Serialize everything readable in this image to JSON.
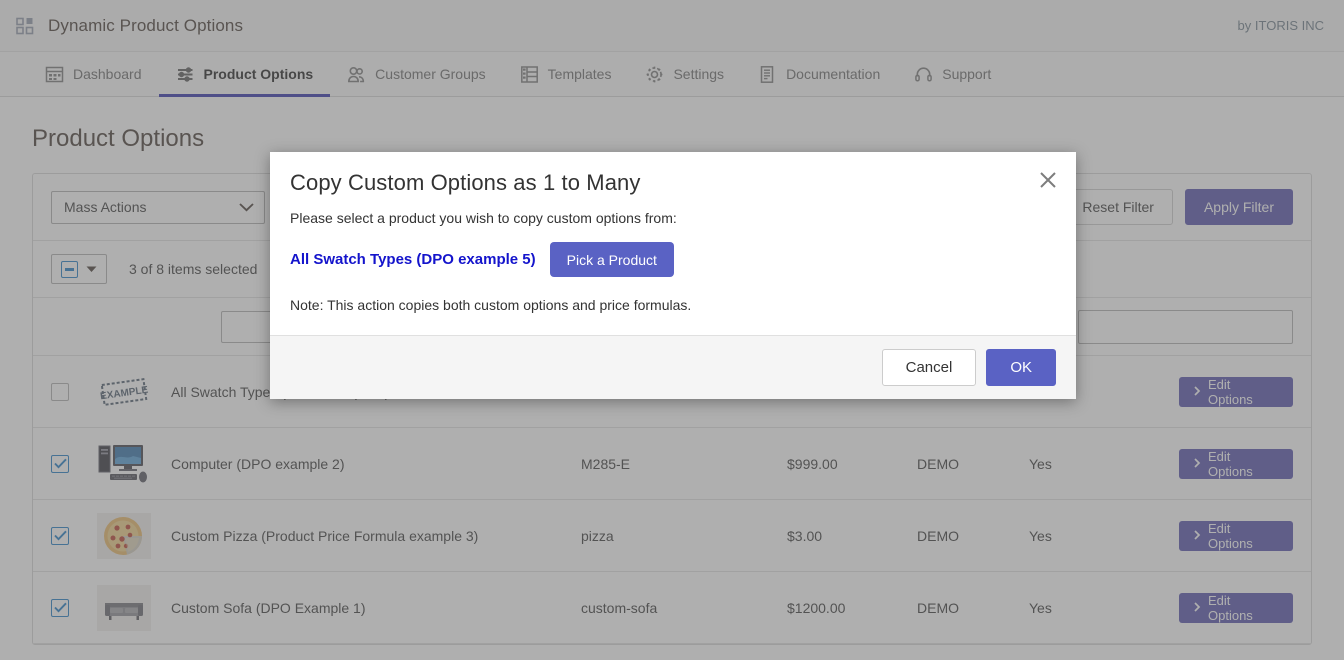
{
  "appbar": {
    "logo_icon": "grid-squares-icon",
    "title": "Dynamic Product Options",
    "vendor": "by ITORIS INC"
  },
  "nav": {
    "items": [
      {
        "label": "Dashboard",
        "icon": "dashboard-icon",
        "active": false
      },
      {
        "label": "Product Options",
        "icon": "sliders-icon",
        "active": true
      },
      {
        "label": "Customer Groups",
        "icon": "users-icon",
        "active": false
      },
      {
        "label": "Templates",
        "icon": "templates-icon",
        "active": false
      },
      {
        "label": "Settings",
        "icon": "gear-icon",
        "active": false
      },
      {
        "label": "Documentation",
        "icon": "document-icon",
        "active": false
      },
      {
        "label": "Support",
        "icon": "headset-icon",
        "active": false
      }
    ]
  },
  "page": {
    "title": "Product Options"
  },
  "toolbar": {
    "mass_actions_label": "Mass Actions",
    "reset_filter_label": "Reset Filter",
    "apply_filter_label": "Apply Filter",
    "selected_text": "3 of 8 items selected",
    "search_value": "",
    "search_placeholder": ""
  },
  "table": {
    "rows": [
      {
        "checked": false,
        "thumb": "example-stamp-thumb",
        "name": "All Swatch Types (DPO example 5)",
        "sku": "",
        "price": "",
        "website": "",
        "has_options": "",
        "action_label": "Edit Options"
      },
      {
        "checked": true,
        "thumb": "computer-thumb",
        "name": "Computer (DPO example 2)",
        "sku": "M285-E",
        "price": "$999.00",
        "website": "DEMO",
        "has_options": "Yes",
        "action_label": "Edit Options"
      },
      {
        "checked": true,
        "thumb": "pizza-thumb",
        "name": "Custom Pizza (Product Price Formula example 3)",
        "sku": "pizza",
        "price": "$3.00",
        "website": "DEMO",
        "has_options": "Yes",
        "action_label": "Edit Options"
      },
      {
        "checked": true,
        "thumb": "sofa-thumb",
        "name": "Custom Sofa (DPO Example 1)",
        "sku": "custom-sofa",
        "price": "$1200.00",
        "website": "DEMO",
        "has_options": "Yes",
        "action_label": "Edit Options"
      }
    ]
  },
  "modal": {
    "title": "Copy Custom Options as 1 to Many",
    "close_icon": "close-icon",
    "lead": "Please select a product you wish to copy custom options from:",
    "product_link": "All Swatch Types (DPO example 5)",
    "pick_button": "Pick a Product",
    "note": "Note: This action copies both custom options and price formulas.",
    "cancel_label": "Cancel",
    "ok_label": "OK"
  },
  "colors": {
    "accent_purple": "#5a62c4",
    "button_purple": "#514da8",
    "nav_active_underline": "#2b2ba8",
    "link_blue": "#1414cc",
    "checkbox_blue": "#1979c3",
    "overlay": "rgba(110,110,110,0.55)"
  }
}
